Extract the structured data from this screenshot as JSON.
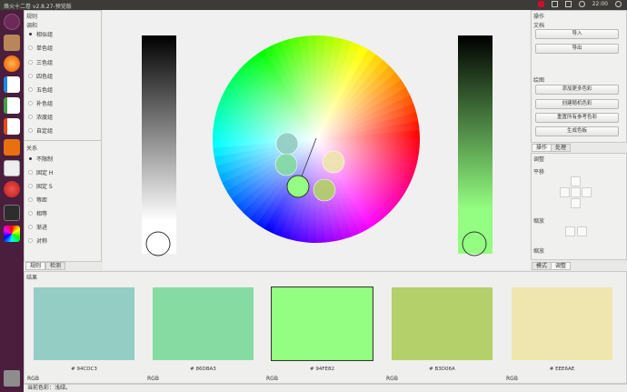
{
  "window": {
    "title": "烙火十二卷 v2.8.27-预览版",
    "clock": "22:00"
  },
  "left_panel": {
    "title": "规则",
    "harmony_label": "调和",
    "harmony_options": [
      "相似组",
      "单色组",
      "三色组",
      "四色组",
      "五色组",
      "补色组",
      "浓度组",
      "自定组"
    ],
    "relation_label": "关系",
    "relation_options": [
      "不限制",
      "固定 H",
      "固定 S",
      "等距",
      "相等",
      "渐进",
      "对称"
    ],
    "tabs": [
      "规则",
      "检测"
    ]
  },
  "right_panel": {
    "title": "操作",
    "file_label": "文档",
    "import_label": "导入",
    "export_label": "导出",
    "swatch_label": "绘图",
    "add_more": "添加更多色彩",
    "random": "创建随机色彩",
    "reset": "重置所有参考色彩",
    "generate": "生成色板",
    "tabs": [
      "操作",
      "处理"
    ],
    "adjust_label": "调整",
    "pan_label": "平移",
    "zoom_label": "缩放",
    "wheel_label": "缩放",
    "bottom_tabs": [
      "模式",
      "调整"
    ]
  },
  "results": {
    "title": "结果",
    "swatches": [
      {
        "hex": "# 94CDC3",
        "color": "#94CDC3",
        "model": "RGB"
      },
      {
        "hex": "# 86DBA3",
        "color": "#86DBA3",
        "model": "RGB"
      },
      {
        "hex": "# 94FE82",
        "color": "#94FE82",
        "model": "RGB"
      },
      {
        "hex": "# B3D06A",
        "color": "#B3D06A",
        "model": "RGB"
      },
      {
        "hex": "# EEE6AE",
        "color": "#EEE6AE",
        "model": "RGB"
      }
    ]
  },
  "status": "当前色彩：浅绿。",
  "wheel": {
    "nodes": [
      {
        "color": "#94CDC3"
      },
      {
        "color": "#86DBA3"
      },
      {
        "color": "#94FE82"
      },
      {
        "color": "#B3D06A"
      },
      {
        "color": "#EEE6AE"
      }
    ]
  }
}
